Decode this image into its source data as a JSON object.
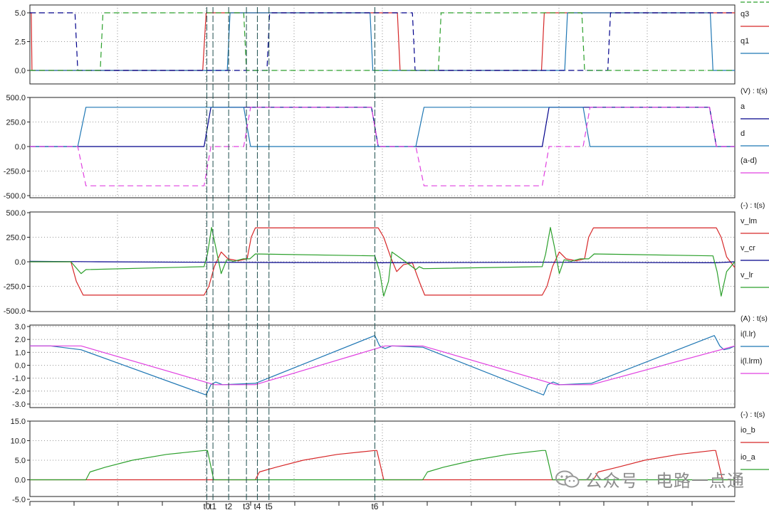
{
  "chart_data": [
    {
      "type": "line",
      "yticks": [
        "5.0",
        "2.5",
        "0.0"
      ],
      "ylim": [
        -0.5,
        5.4
      ],
      "unit_label": "",
      "legend_partial_top": true,
      "series": [
        {
          "name": "q3",
          "color": "#d62728",
          "dash": "",
          "x": [
            0,
            2,
            3,
            253,
            258,
            538,
            542,
            749,
            753,
            1032
          ],
          "y": [
            5,
            5,
            0,
            0,
            5,
            5,
            0,
            0,
            5,
            5
          ]
        },
        {
          "name": "q1",
          "color": "#1f77b4",
          "dash": "",
          "x": [
            0,
            289,
            293,
            498,
            502,
            783,
            787,
            996,
            1000,
            1032
          ],
          "y": [
            0,
            0,
            5,
            5,
            0,
            0,
            5,
            5,
            0,
            0
          ]
        },
        {
          "name": "",
          "color": "#00008b",
          "dash": "8,5",
          "x": [
            0,
            66,
            70,
            347,
            351,
            560,
            564,
            846,
            850,
            1032
          ],
          "y": [
            5,
            5,
            0,
            0,
            5,
            5,
            0,
            0,
            5,
            5
          ]
        },
        {
          "name": "",
          "color": "#2ca02c",
          "dash": "8,5",
          "x": [
            0,
            103,
            107,
            313,
            317,
            598,
            602,
            808,
            812,
            1032
          ],
          "y": [
            0,
            0,
            5,
            5,
            0,
            0,
            5,
            5,
            0,
            0
          ]
        }
      ]
    },
    {
      "type": "line",
      "yticks": [
        "500.0",
        "250.0",
        "0.0",
        "-250.0",
        "-500.0"
      ],
      "ylim": [
        -500,
        500
      ],
      "unit_label": "(V) : t(s)",
      "series": [
        {
          "name": "a",
          "color": "#00008b",
          "dash": "",
          "x": [
            0,
            255,
            265,
            500,
            510,
            750,
            760,
            995,
            1005,
            1032
          ],
          "y": [
            0,
            0,
            400,
            400,
            0,
            0,
            400,
            400,
            0,
            0
          ]
        },
        {
          "name": "d",
          "color": "#1f77b4",
          "dash": "",
          "x": [
            0,
            70,
            82,
            313,
            323,
            565,
            577,
            810,
            820,
            1032
          ],
          "y": [
            0,
            0,
            400,
            400,
            0,
            0,
            400,
            400,
            0,
            0
          ]
        },
        {
          "name": "(a-d)",
          "color": "#e040e0",
          "dash": "8,5",
          "x": [
            0,
            70,
            82,
            255,
            265,
            313,
            323,
            500,
            510,
            565,
            577,
            750,
            760,
            810,
            820,
            995,
            1005,
            1032
          ],
          "y": [
            0,
            0,
            -400,
            -400,
            0,
            0,
            400,
            400,
            0,
            0,
            -400,
            -400,
            0,
            0,
            400,
            400,
            0,
            0
          ]
        }
      ]
    },
    {
      "type": "line",
      "yticks": [
        "500.0",
        "250.0",
        "0.0",
        "-250.0",
        "-500.0"
      ],
      "ylim": [
        -500,
        500
      ],
      "unit_label": "(-) : t(s)",
      "series": [
        {
          "name": "v_lm",
          "color": "#d62728",
          "dash": "",
          "x": [
            0,
            60,
            68,
            78,
            255,
            262,
            270,
            280,
            290,
            305,
            318,
            324,
            330,
            510,
            518,
            528,
            537,
            547,
            560,
            570,
            578,
            750,
            757,
            765,
            775,
            785,
            800,
            812,
            818,
            825,
            1005,
            1012,
            1020,
            1032
          ],
          "y": [
            0,
            0,
            -200,
            -340,
            -340,
            -250,
            -50,
            100,
            30,
            10,
            30,
            250,
            345,
            345,
            250,
            50,
            -100,
            -30,
            -10,
            -200,
            -340,
            -340,
            -250,
            -50,
            100,
            30,
            10,
            30,
            250,
            345,
            345,
            250,
            50,
            -60
          ]
        },
        {
          "name": "v_cr",
          "color": "#00008b",
          "dash": "",
          "x": [
            0,
            100,
            255,
            510,
            750,
            1005,
            1032
          ],
          "y": [
            5,
            0,
            -5,
            -10,
            -5,
            -10,
            0
          ]
        },
        {
          "name": "v_lr",
          "color": "#2ca02c",
          "dash": "",
          "x": [
            0,
            60,
            75,
            82,
            255,
            260,
            266,
            272,
            280,
            288,
            298,
            312,
            322,
            330,
            505,
            512,
            518,
            525,
            530,
            548,
            565,
            570,
            576,
            750,
            755,
            762,
            768,
            775,
            782,
            792,
            805,
            818,
            826,
            1000,
            1006,
            1012,
            1020,
            1032
          ],
          "y": [
            0,
            0,
            -120,
            -80,
            -50,
            80,
            350,
            150,
            -120,
            20,
            5,
            30,
            30,
            80,
            60,
            -100,
            -350,
            -200,
            100,
            10,
            -80,
            -50,
            -70,
            -50,
            80,
            350,
            150,
            -120,
            20,
            5,
            30,
            30,
            80,
            60,
            -100,
            -350,
            -100,
            0
          ]
        }
      ]
    },
    {
      "type": "line",
      "yticks": [
        "3.0",
        "2.0",
        "1.0",
        "0.0",
        "-1.0",
        "-2.0",
        "-3.0"
      ],
      "ylim": [
        -3,
        3
      ],
      "unit_label": "(A) : t(s)",
      "series": [
        {
          "name": "i(l.lr)",
          "color": "#1f77b4",
          "dash": "",
          "x": [
            0,
            30,
            75,
            258,
            265,
            272,
            282,
            330,
            505,
            512,
            520,
            530,
            575,
            752,
            758,
            766,
            776,
            822,
            1002,
            1010,
            1016,
            1024,
            1032
          ],
          "y": [
            1.5,
            1.5,
            1.2,
            -2.3,
            -1.5,
            -1.3,
            -1.5,
            -1.4,
            2.3,
            1.5,
            1.3,
            1.5,
            1.4,
            -2.3,
            -1.5,
            -1.3,
            -1.5,
            -1.4,
            2.3,
            1.5,
            1.2,
            1.3,
            1.5
          ]
        },
        {
          "name": "i(l.lrm)",
          "color": "#e040e0",
          "dash": "",
          "x": [
            0,
            75,
            270,
            330,
            520,
            575,
            770,
            822,
            1032
          ],
          "y": [
            1.5,
            1.5,
            -1.5,
            -1.5,
            1.5,
            1.5,
            -1.5,
            -1.5,
            1.5
          ]
        }
      ]
    },
    {
      "type": "line",
      "yticks": [
        "15.0",
        "10.0",
        "5.0",
        "0.0",
        "-5.0"
      ],
      "ylim": [
        -5,
        15
      ],
      "unit_label": "(-) : t(s)",
      "series": [
        {
          "name": "io_b",
          "color": "#d62728",
          "dash": "",
          "x": [
            0,
            330,
            336,
            360,
            400,
            450,
            505,
            508,
            518,
            825,
            832,
            860,
            900,
            950,
            1000,
            1004,
            1014,
            1032
          ],
          "y": [
            0,
            0,
            2,
            3.2,
            5,
            6.5,
            7.5,
            7.5,
            0,
            0,
            2,
            3.2,
            5,
            6.5,
            7.5,
            7.5,
            0,
            0
          ]
        },
        {
          "name": "io_a",
          "color": "#2ca02c",
          "dash": "",
          "x": [
            0,
            82,
            88,
            110,
            150,
            200,
            255,
            260,
            269,
            575,
            582,
            605,
            650,
            700,
            750,
            755,
            765,
            1032
          ],
          "y": [
            0,
            0,
            2,
            3.2,
            5,
            6.5,
            7.5,
            7.5,
            0,
            0,
            2,
            3.2,
            5,
            6.5,
            7.5,
            7.5,
            0,
            0
          ]
        }
      ]
    }
  ],
  "time_markers": [
    {
      "label": "t0",
      "x": 259
    },
    {
      "label": "t1",
      "x": 268
    },
    {
      "label": "t2",
      "x": 291
    },
    {
      "label": "t3",
      "x": 317
    },
    {
      "label": "t4",
      "x": 333
    },
    {
      "label": "t5",
      "x": 350
    },
    {
      "label": "t6",
      "x": 505
    }
  ],
  "watermark": {
    "text": "公众号 · 电路一点通"
  }
}
